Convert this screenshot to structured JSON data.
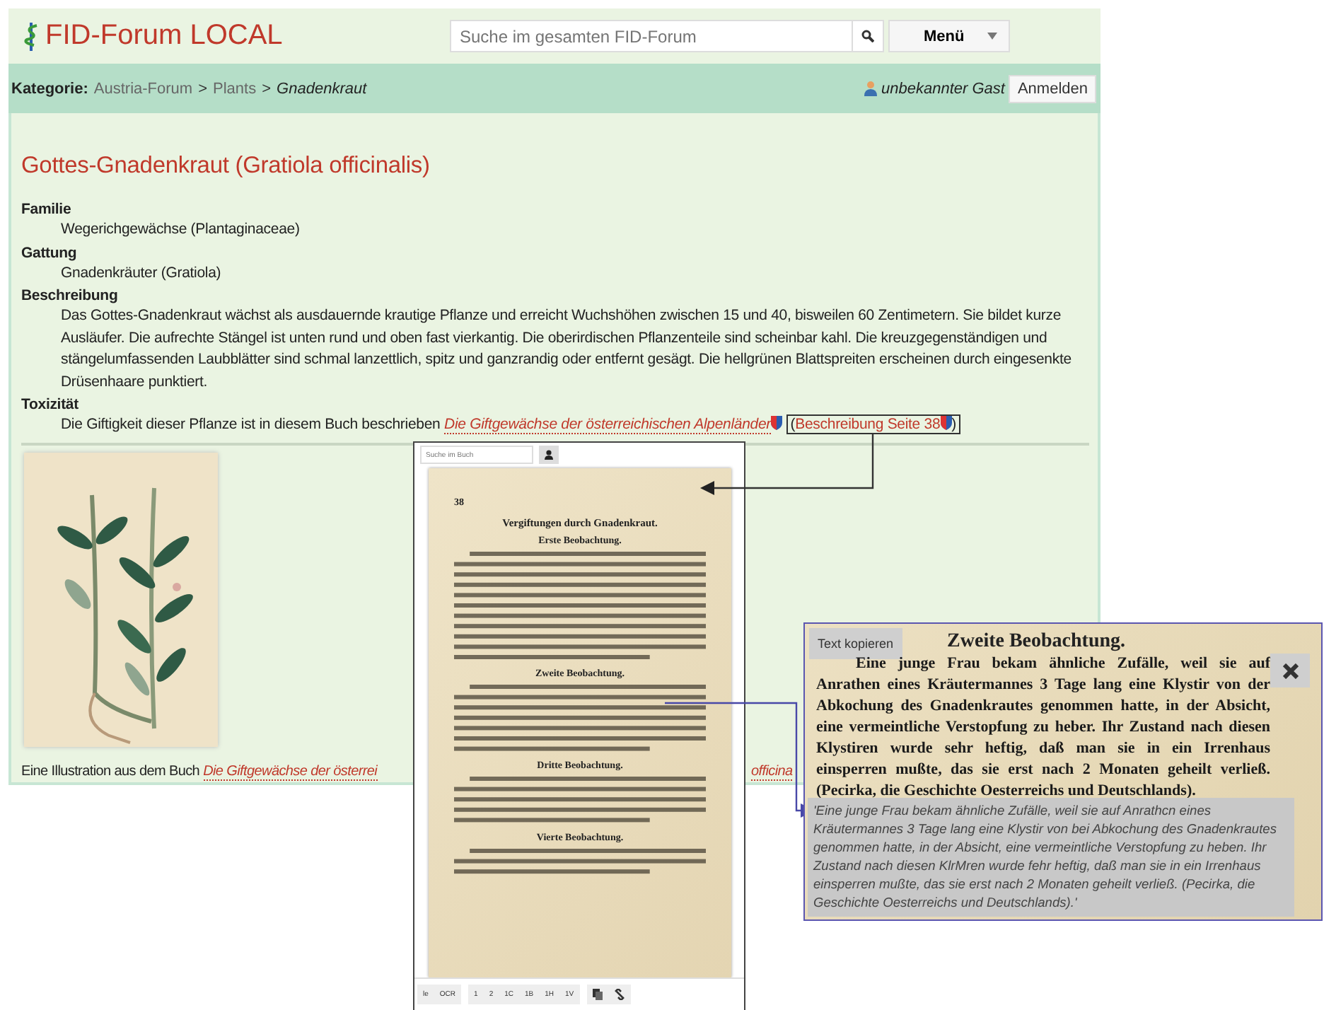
{
  "header": {
    "logo": "FID-Forum LOCAL",
    "search": {
      "placeholder": "Suche im gesamten FID-Forum"
    },
    "menu": "Menü"
  },
  "breadcrumb": {
    "label": "Kategorie:",
    "items": [
      {
        "kind": "link",
        "text": "Austria-Forum"
      },
      {
        "kind": "separator",
        "text": ">"
      },
      {
        "kind": "link",
        "text": "Plants"
      },
      {
        "kind": "separator",
        "text": ">"
      },
      {
        "kind": "current",
        "text": "Gnadenkraut"
      }
    ]
  },
  "user": {
    "name": "unbekannter Gast",
    "login": "Anmelden"
  },
  "article": {
    "title": "Gottes-Gnadenkraut (Gratiola officinalis)",
    "sections": [
      {
        "kind": "text",
        "term": "Familie",
        "text": "Wegerichgewächse (Plantaginaceae)"
      },
      {
        "kind": "text",
        "term": "Gattung",
        "text": "Gnadenkräuter (Gratiola)"
      },
      {
        "kind": "text",
        "term": "Beschreibung",
        "text": "Das Gottes-Gnadenkraut wächst als ausdauernde krautige Pflanze und erreicht Wuchshöhen zwischen 15 und 40, bisweilen 60 Zentimetern. Sie bildet kurze Ausläufer. Die aufrechte Stängel ist unten rund und oben fast vierkantig. Die oberirdischen Pflanzenteile sind scheinbar kahl. Die kreuzgegenständigen und stängelumfassenden Laubblätter sind schmal lanzettlich, spitz und ganzrandig oder entfernt gesägt. Die hellgrünen Blattspreiten erscheinen durch eingesenkte Drüsenhaare punktiert."
      },
      {
        "kind": "citation",
        "term": "Toxizität",
        "text": "Die Giftigkeit dieser Pflanze ist in diesem Buch beschrieben",
        "book": "Die Giftgewächse der österreichischen Alpenländer",
        "open": "(",
        "page": "Beschreibung Seite 38",
        "close": ")"
      }
    ],
    "caption": {
      "text": "Eine Illustration aus dem Buch",
      "link": "Die Giftgewächse der österrei",
      "tail": "officina"
    }
  },
  "viewer": {
    "search": {
      "placeholder": "Suche im Buch"
    },
    "page": {
      "number": "38",
      "blocks": [
        {
          "kind": "title",
          "text": "Vergiftungen durch Gnadenkraut."
        },
        {
          "kind": "heading",
          "text": "Erste Beobachtung."
        },
        {
          "kind": "heading",
          "text": "Zweite Beobachtung."
        },
        {
          "kind": "heading",
          "text": "Dritte Beobachtung."
        },
        {
          "kind": "heading",
          "text": "Vierte Beobachtung."
        }
      ]
    },
    "toolbar": [
      [
        "le",
        "OCR"
      ],
      [
        "1",
        "2",
        "1C",
        "1B",
        "1H",
        "1V"
      ]
    ]
  },
  "popup": {
    "copy": "Text kopieren",
    "scan_title": "Zweite Beobachtung.",
    "scan_text": "Eine junge Frau bekam ähnliche Zufälle, weil sie auf Anrathen eines Kräutermannes 3 Tage lang eine Klystir von der Abkochung des Gnadenkrautes genommen hatte, in der Absicht, eine vermeintliche Verstopfung zu heber. Ihr Zustand nach diesen Klystiren wurde sehr heftig, daß man sie in ein Irrenhaus einsperren mußte, das sie erst nach 2 Monaten geheilt verließ. (Pecirka, die Geschichte Oesterreichs und Deutschlands).",
    "transcription": "'Eine junge Frau bekam ähnliche Zufälle, weil sie auf Anrathcn eines Kräutermannes 3 Tage lang eine Klystir von bei Abkochung des Gnadenkrautes genommen hatte, in der Absicht, eine vermeintliche Verstopfung zu heben. Ihr Zustand nach diesen KlrMren wurde fehr heftig, daß man sie in ein Irrenhaus einsperren mußte, das sie erst nach 2 Monaten geheilt verließ. (Pecirka, die Geschichte Oesterreichs und Deutschlands).'"
  }
}
